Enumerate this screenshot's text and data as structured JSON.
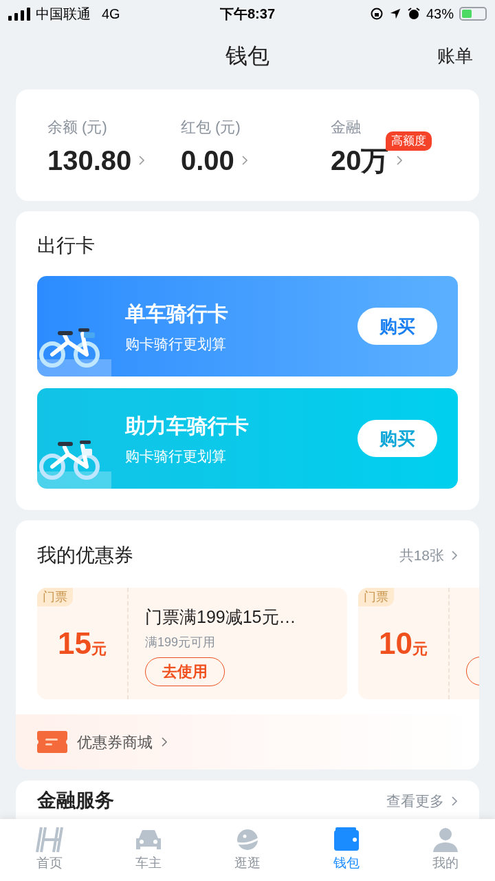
{
  "status_bar": {
    "carrier": "中国联通",
    "network": "4G",
    "time": "下午8:37",
    "battery": "43%"
  },
  "header": {
    "title": "钱包",
    "action": "账单"
  },
  "balances": [
    {
      "label": "余额 (元)",
      "value": "130.80"
    },
    {
      "label": "红包 (元)",
      "value": "0.00"
    },
    {
      "label": "金融",
      "value": "20万",
      "badge": "高额度"
    }
  ],
  "travel_cards": {
    "title": "出行卡",
    "cards": [
      {
        "kind": "bike",
        "title": "单车骑行卡",
        "subtitle": "购卡骑行更划算",
        "button": "购买"
      },
      {
        "kind": "ebike",
        "title": "助力车骑行卡",
        "subtitle": "购卡骑行更划算",
        "button": "购买"
      }
    ]
  },
  "coupons": {
    "title": "我的优惠券",
    "count": "共18张",
    "items": [
      {
        "tag": "门票",
        "amount": "15",
        "unit": "元",
        "title": "门票满199减15元…",
        "condition": "满199元可用",
        "button": "去使用"
      },
      {
        "tag": "门票",
        "amount": "10",
        "unit": "元"
      }
    ],
    "mall_link": "优惠券商城"
  },
  "finance": {
    "title": "金融服务",
    "more": "查看更多"
  },
  "tab_bar": [
    {
      "label": "首页",
      "selected": false
    },
    {
      "label": "车主",
      "selected": false
    },
    {
      "label": "逛逛",
      "selected": false
    },
    {
      "label": "钱包",
      "selected": true
    },
    {
      "label": "我的",
      "selected": false
    }
  ]
}
